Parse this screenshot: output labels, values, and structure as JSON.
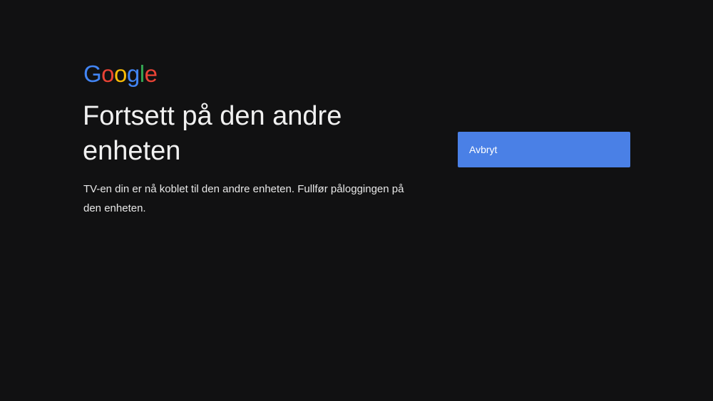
{
  "brand": {
    "logo_letters": [
      {
        "char": "G",
        "color": "#4285F4"
      },
      {
        "char": "o",
        "color": "#EA4335"
      },
      {
        "char": "o",
        "color": "#FBBC05"
      },
      {
        "char": "g",
        "color": "#4285F4"
      },
      {
        "char": "l",
        "color": "#34A853"
      },
      {
        "char": "e",
        "color": "#EA4335"
      }
    ]
  },
  "main": {
    "title": "Fortsett på den andre enheten",
    "description": "TV-en din er nå koblet til den andre enheten. Fullfør påloggingen på den enheten."
  },
  "actions": {
    "cancel_label": "Avbryt"
  },
  "colors": {
    "background": "#111112",
    "button": "#4A80E6",
    "text": "#FFFFFF"
  }
}
